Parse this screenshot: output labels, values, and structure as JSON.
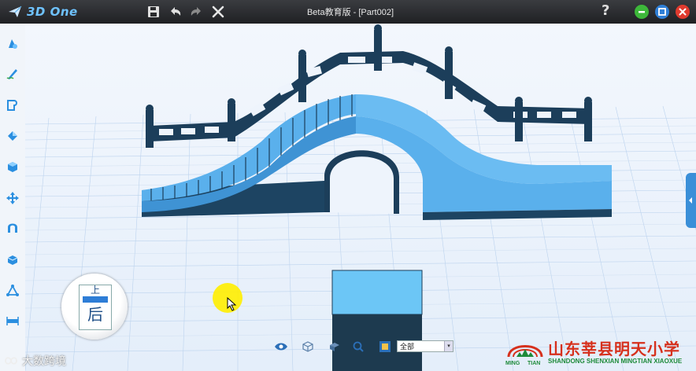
{
  "app": {
    "name": "3D One",
    "window_title": "Beta教育版 - [Part002]"
  },
  "titlebar": {
    "buttons": [
      "save-icon",
      "undo-icon",
      "redo-icon",
      "close-x-icon"
    ],
    "help_label": "?"
  },
  "window_controls": {
    "minimize_color": "#3db83a",
    "restore_color": "#2f7fd6",
    "close_color": "#e03a2e"
  },
  "left_toolbar": {
    "items": [
      "primitive-shapes-icon",
      "sketch-icon",
      "sketch-edit-icon",
      "feature-icon",
      "special-feature-icon",
      "move-icon",
      "adjust-icon",
      "combine-icon",
      "distance-icon",
      "measure-icon"
    ]
  },
  "viewcube": {
    "top_label": "上",
    "front_label": "后"
  },
  "bottom_bar": {
    "icons": [
      "view-eye-icon",
      "render-mode-icon",
      "display-icon",
      "zoom-icon",
      "filter-icon"
    ],
    "filter_value": "全部"
  },
  "watermark": {
    "left_text": "大数跨境",
    "school_cn": "山东莘县明天小学",
    "school_en": "SHANDONG SHENXIAN MINGTIAN XIAOXUE",
    "logo_left": "MING",
    "logo_right": "TIAN"
  },
  "colors": {
    "titlebar": "#2a2b2e",
    "accent_blue": "#3a8fd8",
    "model_light": "#5ab0ec",
    "model_dark": "#1c3e5a",
    "grid_bg": "#eef4fc"
  }
}
